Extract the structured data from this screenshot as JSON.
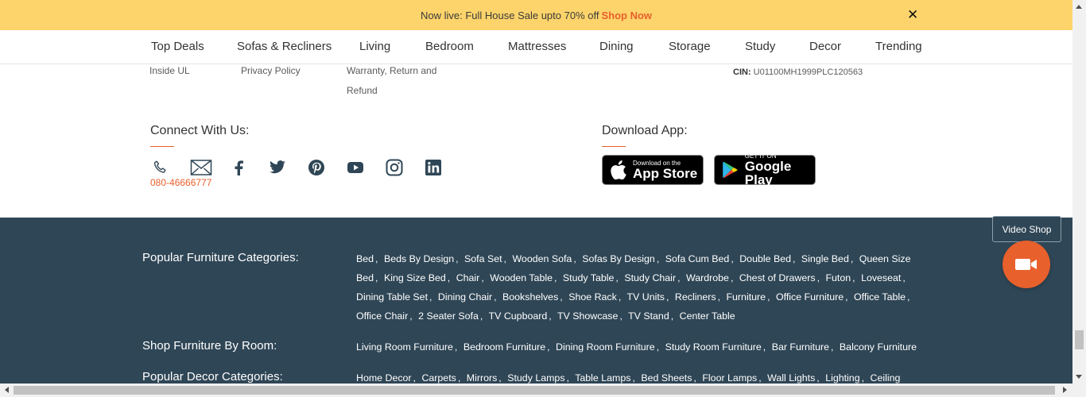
{
  "promo": {
    "text": "Now live: Full House Sale upto 70% off",
    "link": "Shop Now",
    "close": "✕"
  },
  "nav": {
    "items": [
      "Top Deals",
      "Sofas & Recliners",
      "Living",
      "Bedroom",
      "Mattresses",
      "Dining",
      "Storage",
      "Study",
      "Decor",
      "Trending"
    ]
  },
  "footer_links": {
    "col1": "Inside UL",
    "col2": "Privacy Policy",
    "col3_line1": "Warranty, Return and",
    "col3_line2": "Refund",
    "cin_label": "CIN:",
    "cin_value": "U01100MH1999PLC120563"
  },
  "connect": {
    "title": "Connect With Us:",
    "phone": "080-46666777",
    "icons": [
      "phone-icon",
      "mail-icon",
      "facebook-icon",
      "twitter-icon",
      "pinterest-icon",
      "youtube-icon",
      "instagram-icon",
      "linkedin-icon"
    ]
  },
  "download": {
    "title": "Download App:",
    "appstore_small": "Download on the",
    "appstore_big": "App Store",
    "googleplay_small": "GET IT ON",
    "googleplay_big": "Google Play"
  },
  "categories": {
    "popular_furniture": {
      "title": "Popular Furniture Categories:",
      "links": [
        "Bed",
        "Beds By Design",
        "Sofa Set",
        "Wooden Sofa",
        "Sofas By Design",
        "Sofa Cum Bed",
        "Double Bed",
        "Single Bed",
        "Queen Size Bed",
        "King Size Bed",
        "Chair",
        "Wooden Table",
        "Study Table",
        "Study Chair",
        "Wardrobe",
        "Chest of Drawers",
        "Futon",
        "Loveseat",
        "Dining Table Set",
        "Dining Chair",
        "Bookshelves",
        "Shoe Rack",
        "TV Units",
        "Recliners",
        "Furniture",
        "Office Furniture",
        "Office Table",
        "Office Chair",
        "2 Seater Sofa",
        "TV Cupboard",
        "TV Showcase",
        "TV Stand",
        "Center Table"
      ]
    },
    "by_room": {
      "title": "Shop Furniture By Room:",
      "links": [
        "Living Room Furniture",
        "Bedroom Furniture",
        "Dining Room Furniture",
        "Study Room Furniture",
        "Bar Furniture",
        "Balcony Furniture"
      ]
    },
    "popular_decor": {
      "title": "Popular Decor Categories:",
      "links": [
        "Home Decor",
        "Carpets",
        "Mirrors",
        "Study Lamps",
        "Table Lamps",
        "Bed Sheets",
        "Floor Lamps",
        "Wall Lights",
        "Lighting",
        "Ceiling"
      ]
    }
  },
  "video_shop": {
    "label": "Video Shop"
  },
  "colors": {
    "accent": "#e8602c",
    "promo_bg": "#fdd46b",
    "dark_footer": "#2f4656"
  }
}
